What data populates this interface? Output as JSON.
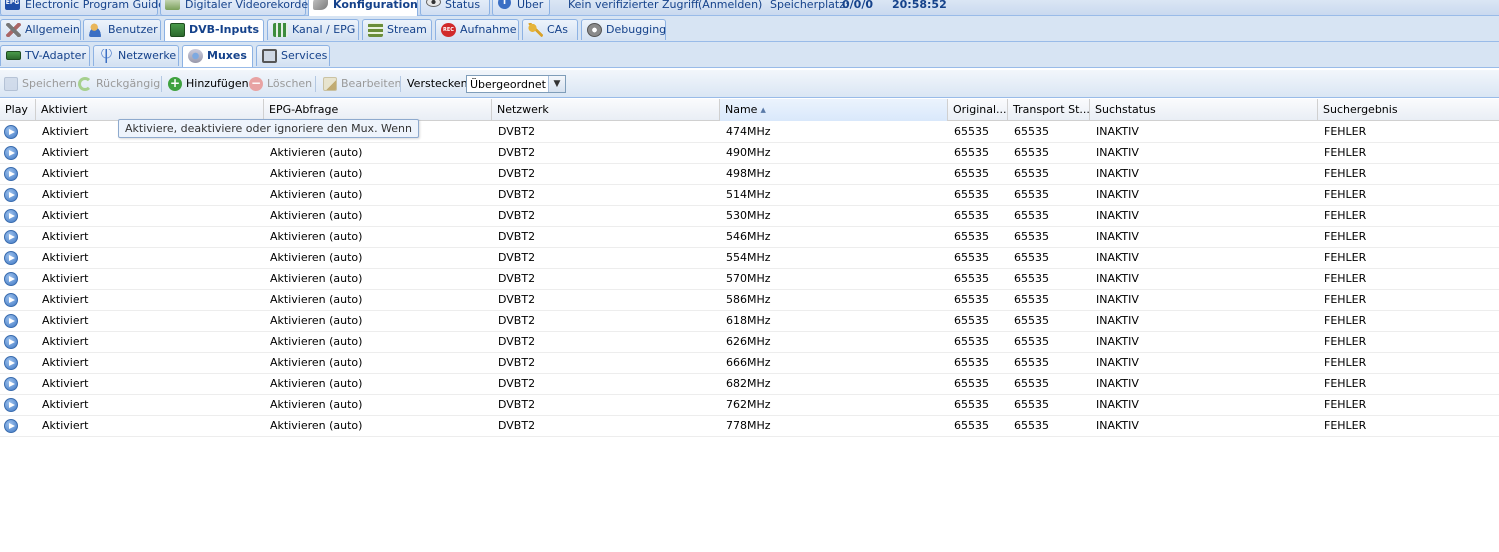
{
  "top_tabs": [
    {
      "label": "Electronic Program Guide",
      "icon": "epg-icon"
    },
    {
      "label": "Digitaler Videorekorder",
      "icon": "dvr-icon"
    },
    {
      "label": "Konfiguration",
      "icon": "wrench-icon",
      "active": true
    },
    {
      "label": "Status",
      "icon": "eye-icon"
    },
    {
      "label": "Über",
      "icon": "info-icon"
    }
  ],
  "status_bar": {
    "access": "Kein verifizierter Zugriff",
    "login": "(Anmelden)",
    "storage_label": "Speicherplatz:",
    "storage_value": "0/0/0",
    "time": "20:58:52"
  },
  "config_tabs": [
    {
      "label": "Allgemein",
      "icon": "tools-icon"
    },
    {
      "label": "Benutzer",
      "icon": "users-icon"
    },
    {
      "label": "DVB-Inputs",
      "icon": "dvb-card-icon",
      "active": true
    },
    {
      "label": "Kanal / EPG",
      "icon": "channel-icon"
    },
    {
      "label": "Stream",
      "icon": "stream-icon"
    },
    {
      "label": "Aufnahme",
      "icon": "rec-icon"
    },
    {
      "label": "CAs",
      "icon": "key-icon"
    },
    {
      "label": "Debugging",
      "icon": "debug-icon"
    }
  ],
  "dvb_tabs": [
    {
      "label": "TV-Adapter",
      "icon": "adapter-icon"
    },
    {
      "label": "Netzwerke",
      "icon": "antenna-icon"
    },
    {
      "label": "Muxes",
      "icon": "mux-icon",
      "active": true
    },
    {
      "label": "Services",
      "icon": "tv-icon"
    }
  ],
  "toolbar": {
    "save": "Speichern",
    "undo": "Rückgängig",
    "add": "Hinzufügen",
    "delete": "Löschen",
    "edit": "Bearbeiten",
    "hide_label": "Verstecken:",
    "hide_value": "Übergeordnet d"
  },
  "columns": [
    "Play",
    "Aktiviert",
    "EPG-Abfrage",
    "Netzwerk",
    "Name",
    "Original...",
    "Transport St...",
    "Suchstatus",
    "Suchergebnis"
  ],
  "sort_column": "Name",
  "tooltip": "Aktiviere, deaktiviere oder ignoriere den Mux. Wenn",
  "rows": [
    {
      "enabled": "Aktiviert",
      "epg": "",
      "network": "DVBT2",
      "name": "474MHz",
      "onid": "65535",
      "tsid": "65535",
      "scan_status": "INAKTIV",
      "scan_result": "FEHLER"
    },
    {
      "enabled": "Aktiviert",
      "epg": "Aktivieren (auto)",
      "network": "DVBT2",
      "name": "490MHz",
      "onid": "65535",
      "tsid": "65535",
      "scan_status": "INAKTIV",
      "scan_result": "FEHLER"
    },
    {
      "enabled": "Aktiviert",
      "epg": "Aktivieren (auto)",
      "network": "DVBT2",
      "name": "498MHz",
      "onid": "65535",
      "tsid": "65535",
      "scan_status": "INAKTIV",
      "scan_result": "FEHLER"
    },
    {
      "enabled": "Aktiviert",
      "epg": "Aktivieren (auto)",
      "network": "DVBT2",
      "name": "514MHz",
      "onid": "65535",
      "tsid": "65535",
      "scan_status": "INAKTIV",
      "scan_result": "FEHLER"
    },
    {
      "enabled": "Aktiviert",
      "epg": "Aktivieren (auto)",
      "network": "DVBT2",
      "name": "530MHz",
      "onid": "65535",
      "tsid": "65535",
      "scan_status": "INAKTIV",
      "scan_result": "FEHLER"
    },
    {
      "enabled": "Aktiviert",
      "epg": "Aktivieren (auto)",
      "network": "DVBT2",
      "name": "546MHz",
      "onid": "65535",
      "tsid": "65535",
      "scan_status": "INAKTIV",
      "scan_result": "FEHLER"
    },
    {
      "enabled": "Aktiviert",
      "epg": "Aktivieren (auto)",
      "network": "DVBT2",
      "name": "554MHz",
      "onid": "65535",
      "tsid": "65535",
      "scan_status": "INAKTIV",
      "scan_result": "FEHLER"
    },
    {
      "enabled": "Aktiviert",
      "epg": "Aktivieren (auto)",
      "network": "DVBT2",
      "name": "570MHz",
      "onid": "65535",
      "tsid": "65535",
      "scan_status": "INAKTIV",
      "scan_result": "FEHLER"
    },
    {
      "enabled": "Aktiviert",
      "epg": "Aktivieren (auto)",
      "network": "DVBT2",
      "name": "586MHz",
      "onid": "65535",
      "tsid": "65535",
      "scan_status": "INAKTIV",
      "scan_result": "FEHLER"
    },
    {
      "enabled": "Aktiviert",
      "epg": "Aktivieren (auto)",
      "network": "DVBT2",
      "name": "618MHz",
      "onid": "65535",
      "tsid": "65535",
      "scan_status": "INAKTIV",
      "scan_result": "FEHLER"
    },
    {
      "enabled": "Aktiviert",
      "epg": "Aktivieren (auto)",
      "network": "DVBT2",
      "name": "626MHz",
      "onid": "65535",
      "tsid": "65535",
      "scan_status": "INAKTIV",
      "scan_result": "FEHLER"
    },
    {
      "enabled": "Aktiviert",
      "epg": "Aktivieren (auto)",
      "network": "DVBT2",
      "name": "666MHz",
      "onid": "65535",
      "tsid": "65535",
      "scan_status": "INAKTIV",
      "scan_result": "FEHLER"
    },
    {
      "enabled": "Aktiviert",
      "epg": "Aktivieren (auto)",
      "network": "DVBT2",
      "name": "682MHz",
      "onid": "65535",
      "tsid": "65535",
      "scan_status": "INAKTIV",
      "scan_result": "FEHLER"
    },
    {
      "enabled": "Aktiviert",
      "epg": "Aktivieren (auto)",
      "network": "DVBT2",
      "name": "762MHz",
      "onid": "65535",
      "tsid": "65535",
      "scan_status": "INAKTIV",
      "scan_result": "FEHLER"
    },
    {
      "enabled": "Aktiviert",
      "epg": "Aktivieren (auto)",
      "network": "DVBT2",
      "name": "778MHz",
      "onid": "65535",
      "tsid": "65535",
      "scan_status": "INAKTIV",
      "scan_result": "FEHLER"
    }
  ]
}
